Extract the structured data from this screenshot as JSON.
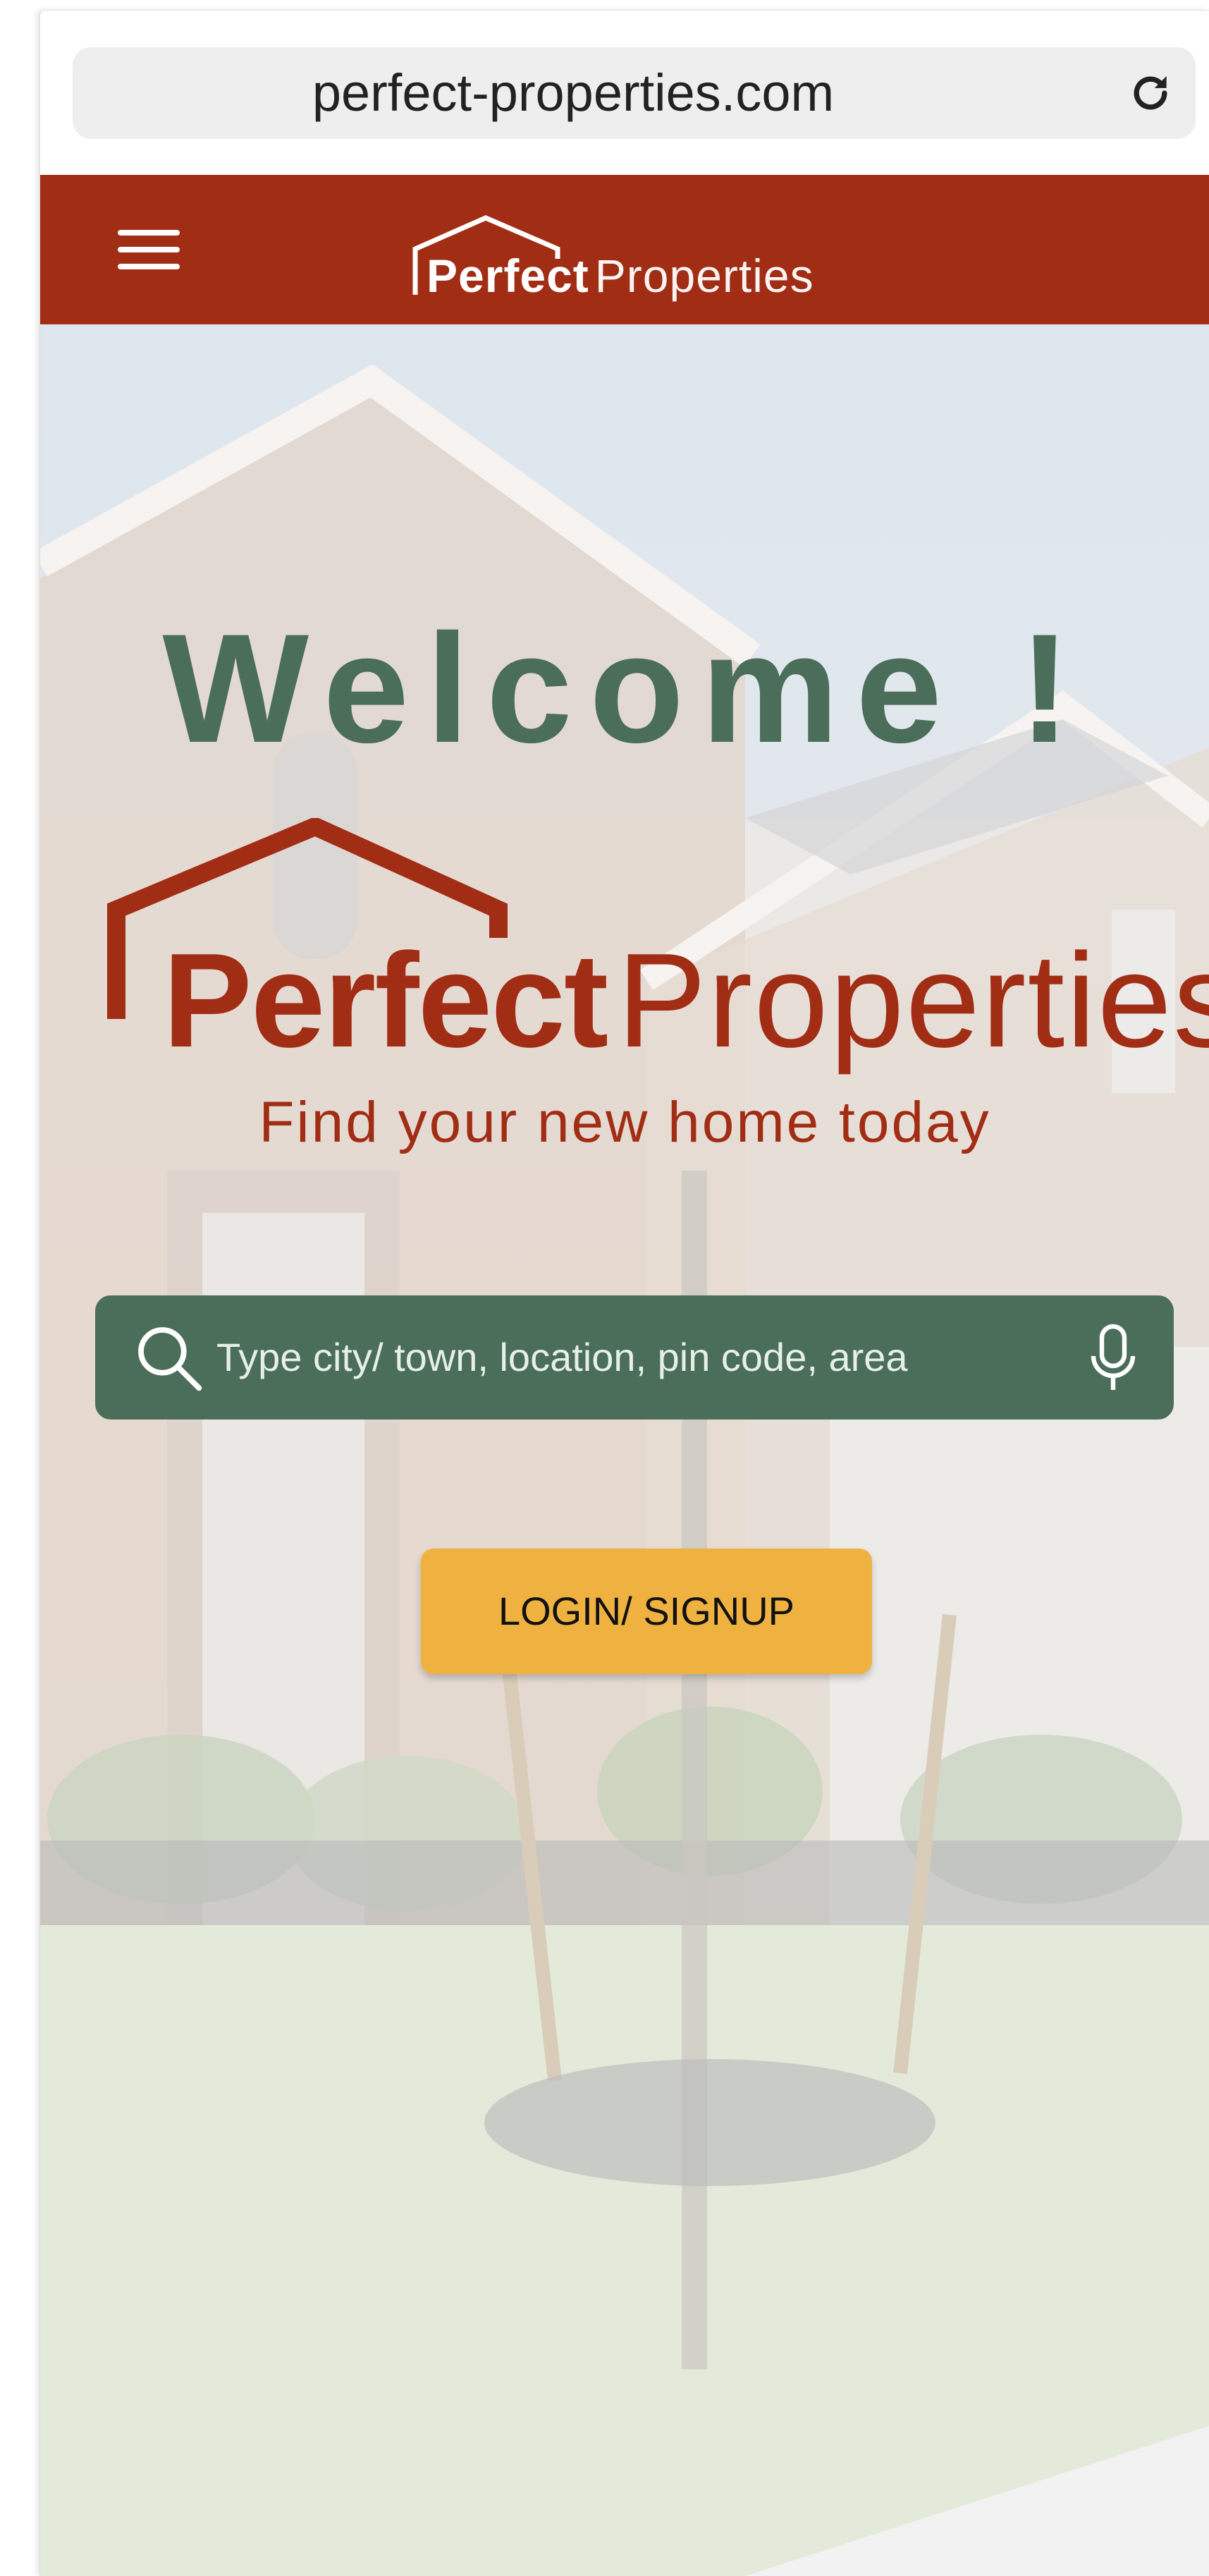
{
  "browser": {
    "url": "perfect-properties.com",
    "reload_icon": "reload-icon"
  },
  "header": {
    "menu_icon": "hamburger-menu-icon",
    "logo_bold": "Perfect",
    "logo_light": "Properties",
    "background_color": "#a22d15"
  },
  "hero": {
    "welcome": "Welcome !",
    "logo_bold": "Perfect",
    "logo_light": "Properties",
    "tagline": "Find your new home today"
  },
  "search": {
    "placeholder": "Type city/ town, location, pin code, area",
    "search_icon": "search-icon",
    "mic_icon": "microphone-icon",
    "background_color": "#4b6e5a"
  },
  "login_button": {
    "label": "LOGIN/ SIGNUP",
    "background_color": "#efb241"
  }
}
